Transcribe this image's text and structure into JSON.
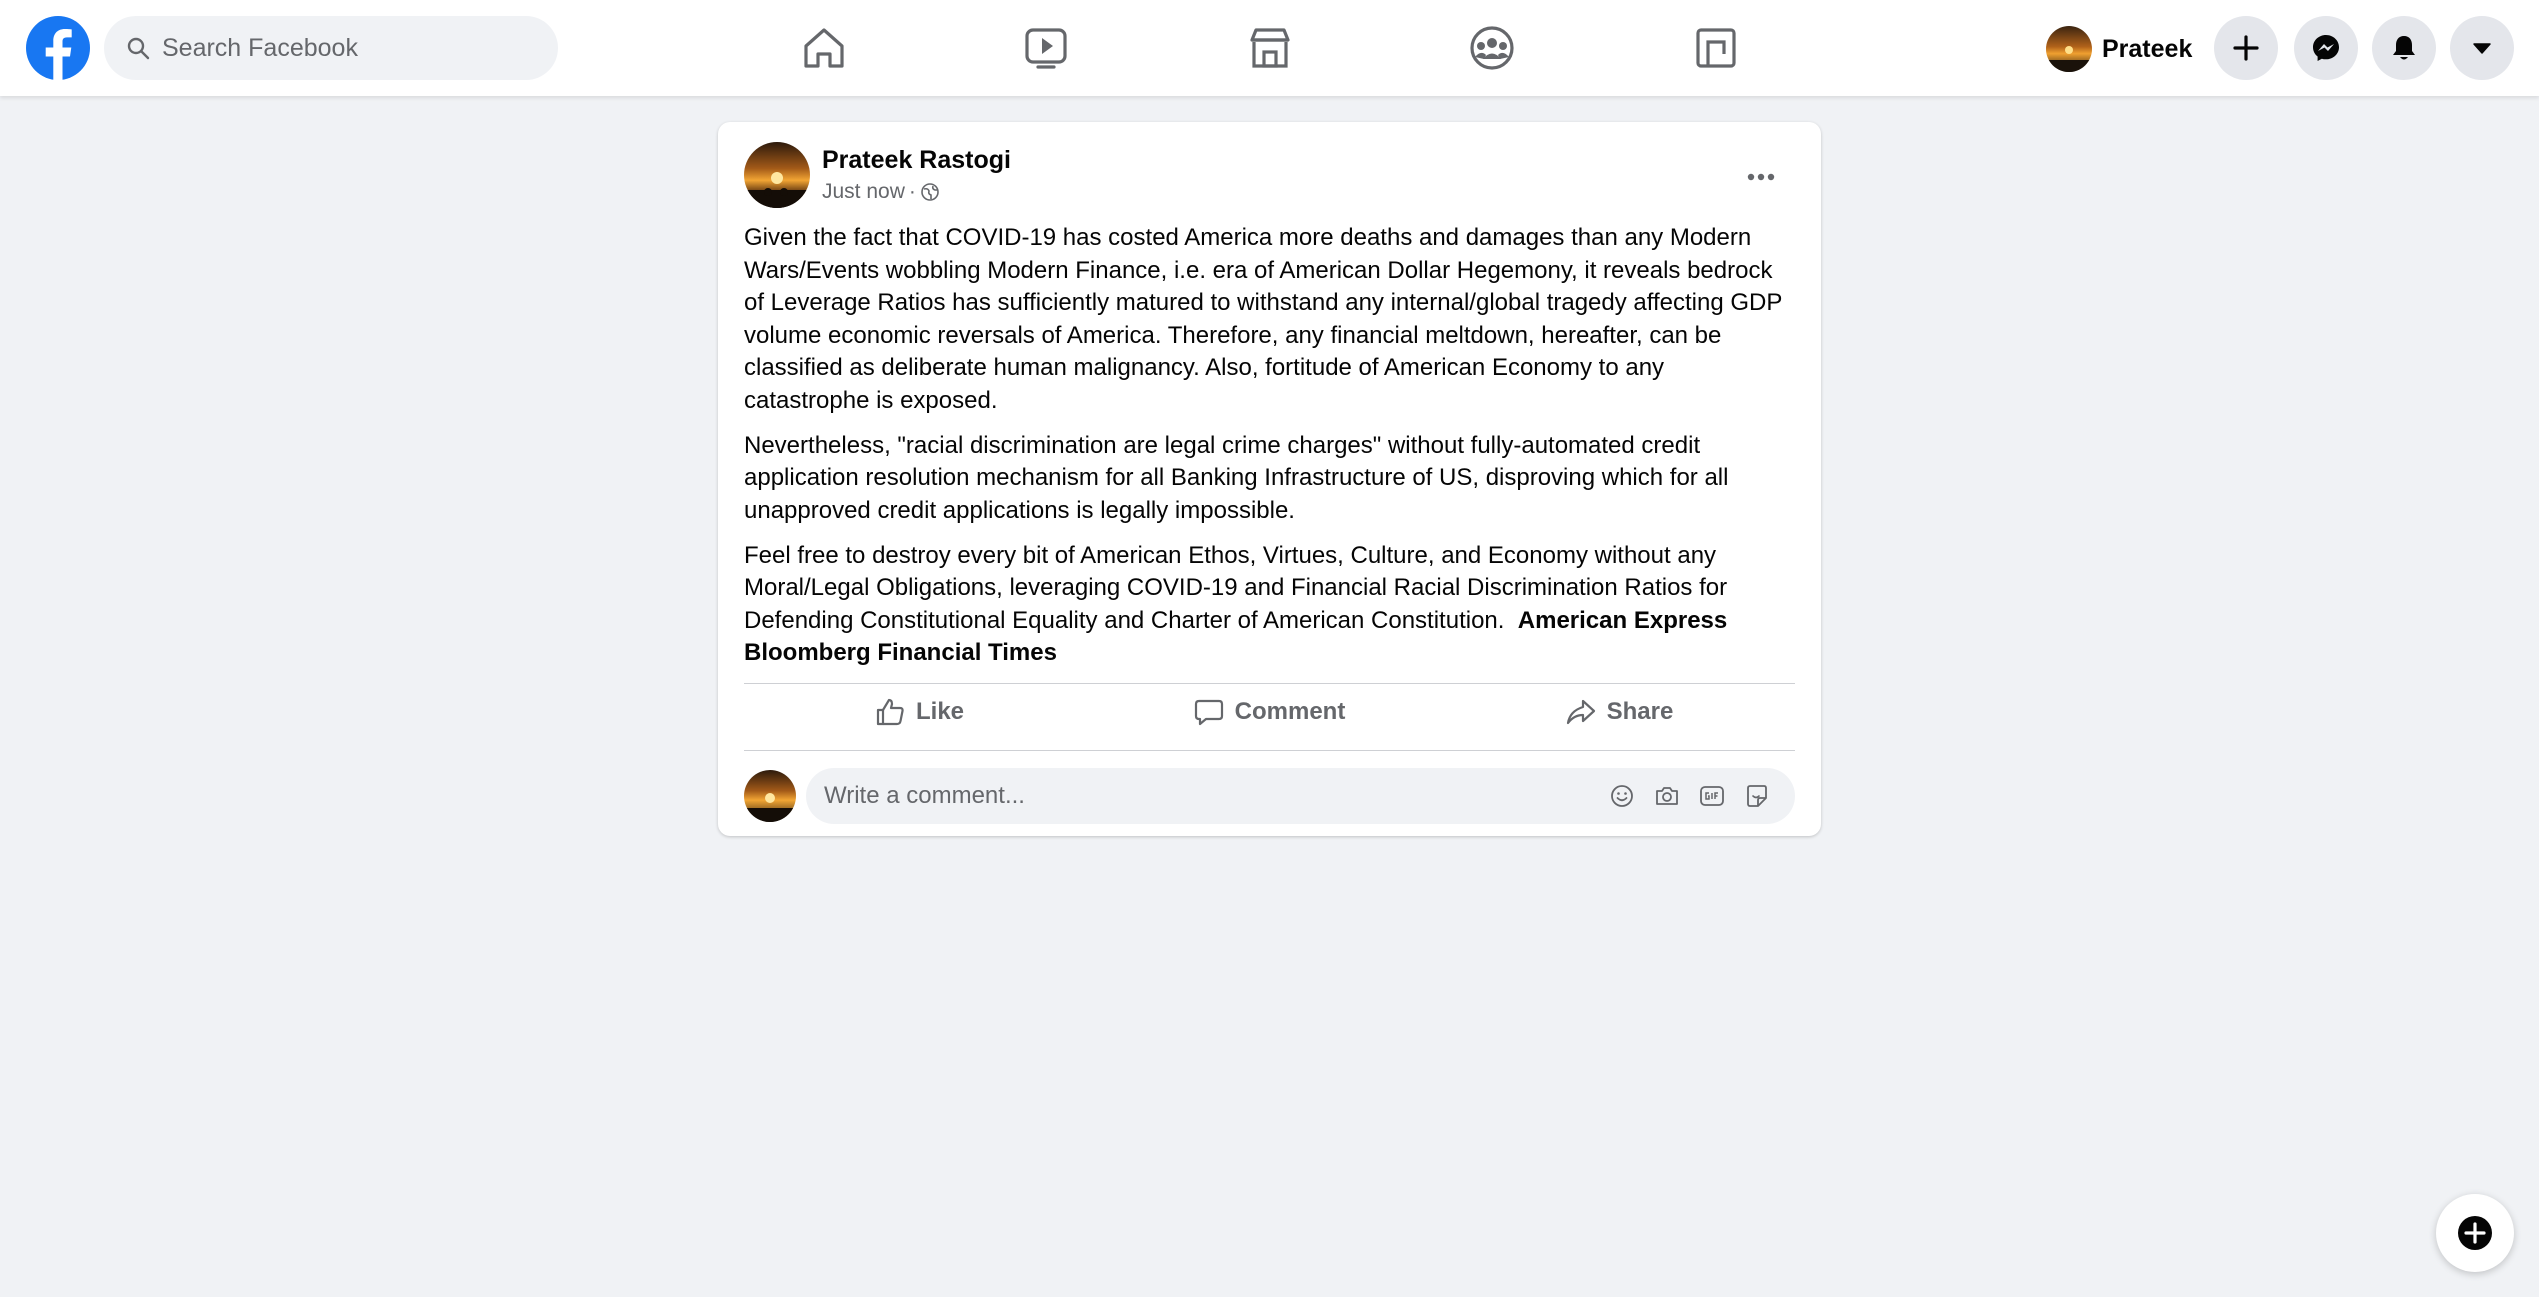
{
  "search": {
    "placeholder": "Search Facebook"
  },
  "nav": {
    "icons": [
      "home-icon",
      "watch-icon",
      "marketplace-icon",
      "groups-icon",
      "gaming-icon"
    ]
  },
  "profile": {
    "name": "Prateek"
  },
  "header_buttons": [
    "create-plus-icon",
    "messenger-icon",
    "notifications-bell-icon",
    "account-caret-icon"
  ],
  "post": {
    "author": "Prateek Rastogi",
    "time": "Just now",
    "separator": "·",
    "privacy_icon": "globe-icon",
    "paragraphs": [
      "Given the fact that COVID-19 has costed America more deaths and damages than any Modern Wars/Events wobbling Modern Finance, i.e. era of American Dollar Hegemony, it reveals bedrock of Leverage Ratios has sufficiently matured to withstand any internal/global tragedy affecting GDP volume economic reversals of America. Therefore, any financial meltdown, hereafter, can be classified as deliberate human malignancy. Also, fortitude of American Economy to any catastrophe is exposed.",
      "Nevertheless, \"racial discrimination are legal crime charges\" without fully-automated credit application resolution mechanism for all Banking Infrastructure of US, disproving which for all unapproved credit applications is legally impossible."
    ],
    "paragraph3_text": "Feel free to destroy every bit of American Ethos, Virtues, Culture, and Economy without any Moral/Legal Obligations, leveraging COVID-19 and Financial Racial Discrimination Ratios for Defending Constitutional Equality and Charter of American Constitution.",
    "tag1": "American Express",
    "tag2": "Bloomberg",
    "tag3": "Financial Times",
    "actions": {
      "like": "Like",
      "comment": "Comment",
      "share": "Share"
    },
    "comment_placeholder": "Write a comment..."
  },
  "colors": {
    "brand": "#1877f2",
    "background": "#f0f2f5",
    "secondary_text": "#65676b"
  }
}
